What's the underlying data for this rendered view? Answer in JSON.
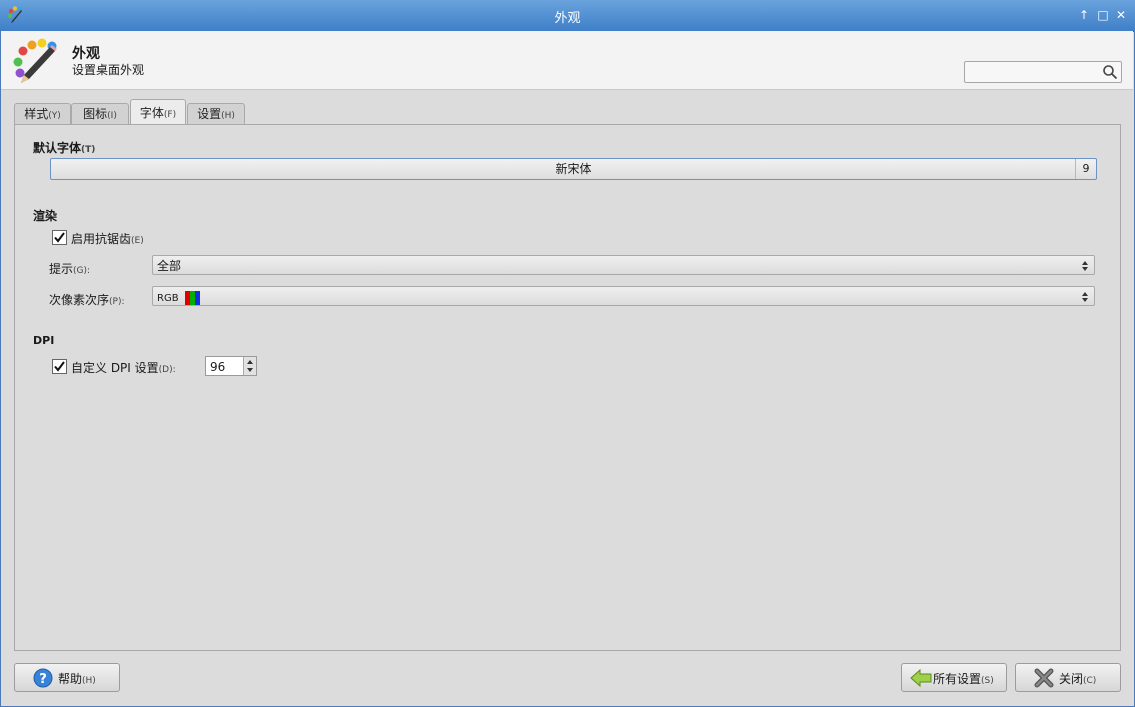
{
  "window": {
    "title": "外观"
  },
  "header": {
    "title": "外观",
    "subtitle": "设置桌面外观",
    "search_placeholder": ""
  },
  "tabs": [
    {
      "label": "样式",
      "mnemonic": "(Y)"
    },
    {
      "label": "图标",
      "mnemonic": "(I)"
    },
    {
      "label": "字体",
      "mnemonic": "(F)"
    },
    {
      "label": "设置",
      "mnemonic": "(H)"
    }
  ],
  "default_font": {
    "heading": "默认字体",
    "mnemonic": "(T)",
    "font_name": "新宋体",
    "font_size": "9"
  },
  "rendering": {
    "heading": "渲染",
    "antialias_label": "启用抗锯齿",
    "antialias_mnemonic": "(E)",
    "antialias_checked": true,
    "hint_label": "提示",
    "hint_mnemonic": "(G):",
    "hint_value": "全部",
    "subpixel_label": "次像素次序",
    "subpixel_mnemonic": "(P):",
    "subpixel_value": "RGB"
  },
  "dpi": {
    "heading": "DPI",
    "custom_label": "自定义 DPI 设置",
    "custom_mnemonic": "(D):",
    "custom_checked": true,
    "value": "96"
  },
  "buttons": {
    "help": {
      "label": "帮助",
      "mnemonic": "(H)"
    },
    "all_settings": {
      "label": "所有设置",
      "mnemonic": "(S)"
    },
    "close": {
      "label": "关闭",
      "mnemonic": "(C)"
    }
  },
  "colors": {
    "titlebar": "#4f8fd3",
    "focus_border": "#6c92c6",
    "rgb_red": "#e00000",
    "rgb_green": "#00b000",
    "rgb_blue": "#1030e0"
  }
}
